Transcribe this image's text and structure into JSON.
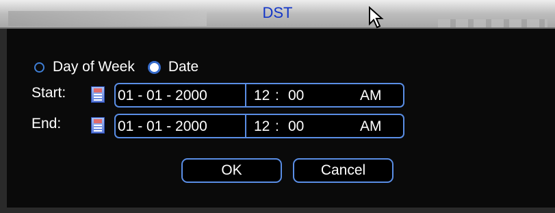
{
  "dialog": {
    "title": "DST"
  },
  "mode": {
    "options": [
      {
        "label": "Day of Week",
        "selected": false
      },
      {
        "label": "Date",
        "selected": true
      }
    ]
  },
  "start": {
    "label": "Start:",
    "date": "01 - 01 - 2000",
    "hour": "12",
    "minute": "00",
    "ampm": "AM"
  },
  "end": {
    "label": "End:",
    "date": "01 - 01 - 2000",
    "hour": "12",
    "minute": "00",
    "ampm": "AM"
  },
  "buttons": {
    "ok": "OK",
    "cancel": "Cancel"
  },
  "colors": {
    "accent": "#5a8ee6",
    "title_text": "#1235c8",
    "background": "#000000"
  },
  "icons": [
    "calendar-icon",
    "mouse-pointer-icon",
    "radio-unchecked-icon",
    "radio-checked-icon"
  ]
}
